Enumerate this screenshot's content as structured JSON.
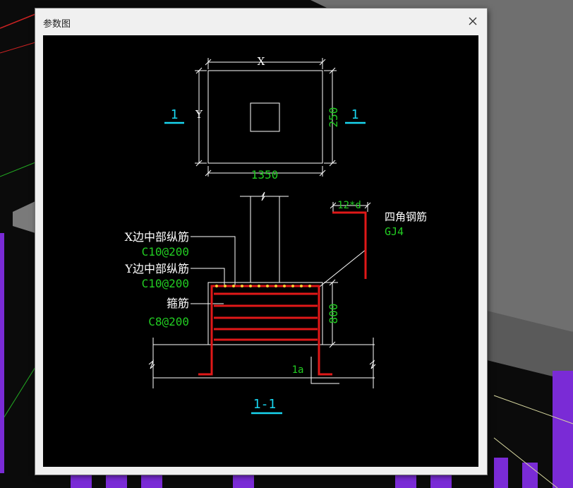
{
  "window": {
    "title": "参数图"
  },
  "colors": {
    "canvas_bg": "#000000",
    "line": "#ffffff",
    "dim_value": "#22cc22",
    "section_mark": "#19d6f0",
    "rebar": "#e01818",
    "rebar_dots": "#ffcc33"
  },
  "plan": {
    "dim_x_label": "X",
    "dim_y_label": "Y",
    "dim_width_value": "1350",
    "dim_height_value": "250",
    "section_left": "1",
    "section_right": "1"
  },
  "section": {
    "x_rebar_label": "X边中部纵筋",
    "x_rebar_value": "C10@200",
    "y_rebar_label": "Y边中部纵筋",
    "y_rebar_value": "C10@200",
    "stirrup_label": "箍筋",
    "stirrup_value": "C8@200",
    "corner_label": "四角钢筋",
    "corner_value": "GJ4",
    "hook_length": "12*d",
    "height_value": "800",
    "anchor_label": "1a",
    "section_title": "1-1"
  }
}
